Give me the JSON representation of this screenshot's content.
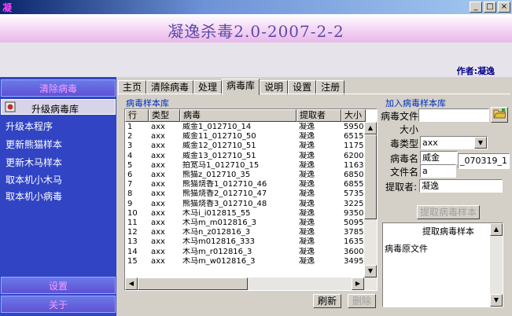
{
  "window": {
    "title": "凝"
  },
  "banner": {
    "title": "凝逸杀毒2.0-2007-2-2"
  },
  "author": "作者:凝逸",
  "sidebar": {
    "top_button": "清除病毒",
    "category": "升级病毒库",
    "items": [
      "升级本程序",
      "更新熊猫样本",
      "更新木马样本",
      "取本机小木马",
      "取本机小病毒"
    ],
    "settings": "设置",
    "about": "关于"
  },
  "tabs": [
    "主页",
    "清除病毒",
    "处理",
    "病毒库",
    "说明",
    "设置",
    "注册"
  ],
  "library": {
    "section": "病毒样本库",
    "columns": [
      "行",
      "类型",
      "病毒",
      "提取者",
      "大小"
    ],
    "rows": [
      [
        "1",
        "axx",
        "威金1_012710_14",
        "凝逸",
        "5950"
      ],
      [
        "2",
        "axx",
        "威金11_012710_50",
        "凝逸",
        "6515"
      ],
      [
        "3",
        "axx",
        "威金12_012710_51",
        "凝逸",
        "1175"
      ],
      [
        "4",
        "axx",
        "威金13_012710_51",
        "凝逸",
        "6200"
      ],
      [
        "5",
        "axx",
        "拍宽马1_012710_15",
        "凝逸",
        "1163"
      ],
      [
        "6",
        "axx",
        "熊猫z_012710_35",
        "凝逸",
        "6850"
      ],
      [
        "7",
        "axx",
        "熊猫烧香1_012710_46",
        "凝逸",
        "6855"
      ],
      [
        "8",
        "axx",
        "熊猫烧香2_012710_47",
        "凝逸",
        "5735"
      ],
      [
        "9",
        "axx",
        "熊猫烧香3_012710_48",
        "凝逸",
        "3225"
      ],
      [
        "10",
        "axx",
        "木马i_i012815_55",
        "凝逸",
        "9350"
      ],
      [
        "11",
        "axx",
        "木马m_m012816_3",
        "凝逸",
        "5095"
      ],
      [
        "12",
        "axx",
        "木马n_z012816_3",
        "凝逸",
        "3785"
      ],
      [
        "13",
        "axx",
        "木马m012816_333",
        "凝逸",
        "1635"
      ],
      [
        "14",
        "axx",
        "木马m_r012816_3",
        "凝逸",
        "3600"
      ],
      [
        "15",
        "axx",
        "木马m_w012816_3",
        "凝逸",
        "3495"
      ]
    ],
    "refresh": "刷新",
    "delete": "删除"
  },
  "addpanel": {
    "section": "加入病毒样本库",
    "file_label": "病毒文件",
    "file_value": "",
    "size_label": "大小",
    "type_label": "毒类型",
    "type_value": "axx",
    "name_label": "病毒名",
    "name_value": "威金",
    "name_suffix": "_070319_1",
    "filename_label": "文件名",
    "filename_value": "a",
    "extractor_label": "提取者:",
    "extractor_value": "凝逸",
    "extract_button": "提取病毒样本",
    "memo_lines": [
      "提取病毒样本",
      "病毒原文件"
    ]
  }
}
